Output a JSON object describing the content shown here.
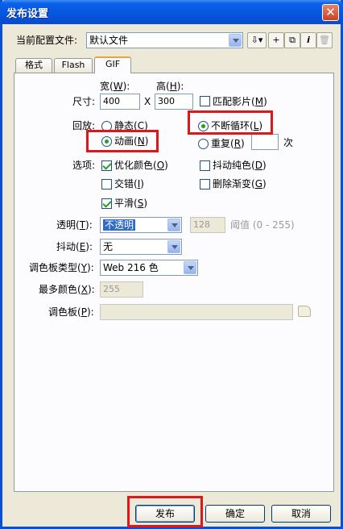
{
  "window": {
    "title": "发布设置",
    "close_glyph": "✕"
  },
  "profile": {
    "label": "当前配置文件:",
    "value": "默认文件"
  },
  "toolbar_icons": [
    "import-export-icon",
    "add-profile-icon",
    "duplicate-profile-icon",
    "info-icon",
    "delete-profile-icon"
  ],
  "tabs": [
    {
      "label": "格式"
    },
    {
      "label": "Flash"
    },
    {
      "label": "GIF"
    }
  ],
  "dimensions": {
    "label": "尺寸:",
    "width_label": "宽",
    "width_key": "W",
    "height_label": "高",
    "height_key": "H",
    "width": "400",
    "x": "X",
    "height": "300",
    "match_movie": "匹配影片",
    "match_key": "M"
  },
  "playback": {
    "label": "回放:",
    "static": "静态",
    "static_key": "C",
    "animated": "动画",
    "animated_key": "N",
    "loop": "不断循环",
    "loop_key": "L",
    "repeat": "重复",
    "repeat_key": "R",
    "repeat_value": "",
    "times": "次"
  },
  "options": {
    "label": "选项:",
    "optimize": "优化颜色",
    "optimize_key": "O",
    "dither_solids": "抖动纯色",
    "dither_solids_key": "D",
    "interlace": "交错",
    "interlace_key": "I",
    "remove_gradients": "删除渐变",
    "remove_gradients_key": "G",
    "smooth": "平滑",
    "smooth_key": "S"
  },
  "transparent": {
    "label": "透明",
    "key": "T",
    "value": "不透明",
    "threshold": "128",
    "threshold_label": "阈值 (0 - 255)"
  },
  "dither": {
    "label": "抖动",
    "key": "E",
    "value": "无"
  },
  "palette_type": {
    "label": "调色板类型",
    "key": "Y",
    "value": "Web 216 色"
  },
  "max_colors": {
    "label": "最多颜色",
    "key": "X",
    "value": "255"
  },
  "palette": {
    "label": "调色板",
    "key": "P",
    "value": ""
  },
  "buttons": {
    "publish": "发布",
    "ok": "确定",
    "cancel": "取消"
  },
  "colors": {
    "title_bar": "#0655df",
    "highlight_box": "#e0161a",
    "window_bg": "#ece9d8"
  }
}
